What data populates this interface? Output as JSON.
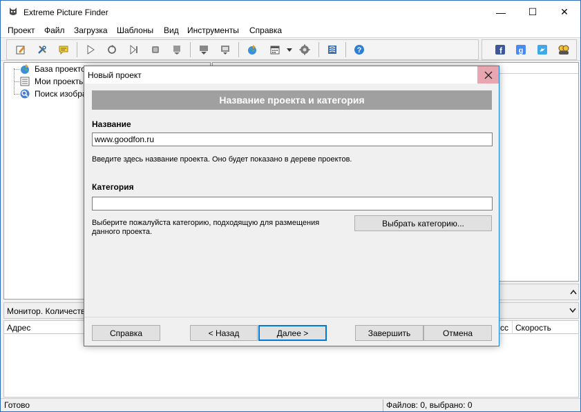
{
  "app": {
    "title": "Extreme Picture Finder",
    "window_controls": {
      "minimize": "—",
      "maximize": "☐",
      "close": "✕"
    }
  },
  "menu": [
    {
      "label": "Проект"
    },
    {
      "label": "Файл"
    },
    {
      "label": "Загрузка"
    },
    {
      "label": "Шаблоны"
    },
    {
      "label": "Вид"
    },
    {
      "label": "Инструменты"
    },
    {
      "label": "Справка"
    }
  ],
  "toolbar": {
    "icons": [
      "edit-icon",
      "settings-wrench-icon",
      "comment-icon",
      "play-icon",
      "refresh-icon",
      "step-icon",
      "stop-icon",
      "queue-icon",
      "download-icon",
      "monitor-icon",
      "globe-icon",
      "calendar-icon",
      "dropdown-icon",
      "gear-icon",
      "list-icon",
      "help-icon"
    ],
    "social": [
      "facebook-icon",
      "google-icon",
      "twitter-icon",
      "people-icon"
    ]
  },
  "tree": {
    "items": [
      {
        "label": "База проектов",
        "icon": "globe-icon"
      },
      {
        "label": "Мои проекты",
        "icon": "list-icon"
      },
      {
        "label": "Поиск изобра",
        "icon": "search-icon"
      }
    ]
  },
  "monitor": {
    "label": "Монитор. Количество с"
  },
  "list": {
    "columns": [
      "Адрес",
      "сс",
      "Скорость"
    ]
  },
  "status": {
    "left": "Готово",
    "right": "Файлов: 0, выбрано: 0"
  },
  "dialog": {
    "title": "Новый проект",
    "banner": "Название проекта и категория",
    "name_label": "Название",
    "name_value": "www.goodfon.ru",
    "name_help": "Введите здесь название проекта. Оно будет показано в дереве проектов.",
    "category_label": "Категория",
    "category_value": "",
    "category_help_line1": "Выберите пожалуйста категорию, подходящую для размещения",
    "category_help_line2": "данного проекта.",
    "choose_category_button": "Выбрать категорию...",
    "buttons": {
      "help": "Справка",
      "back": "< Назад",
      "next": "Далее >",
      "finish": "Завершить",
      "cancel": "Отмена"
    }
  }
}
